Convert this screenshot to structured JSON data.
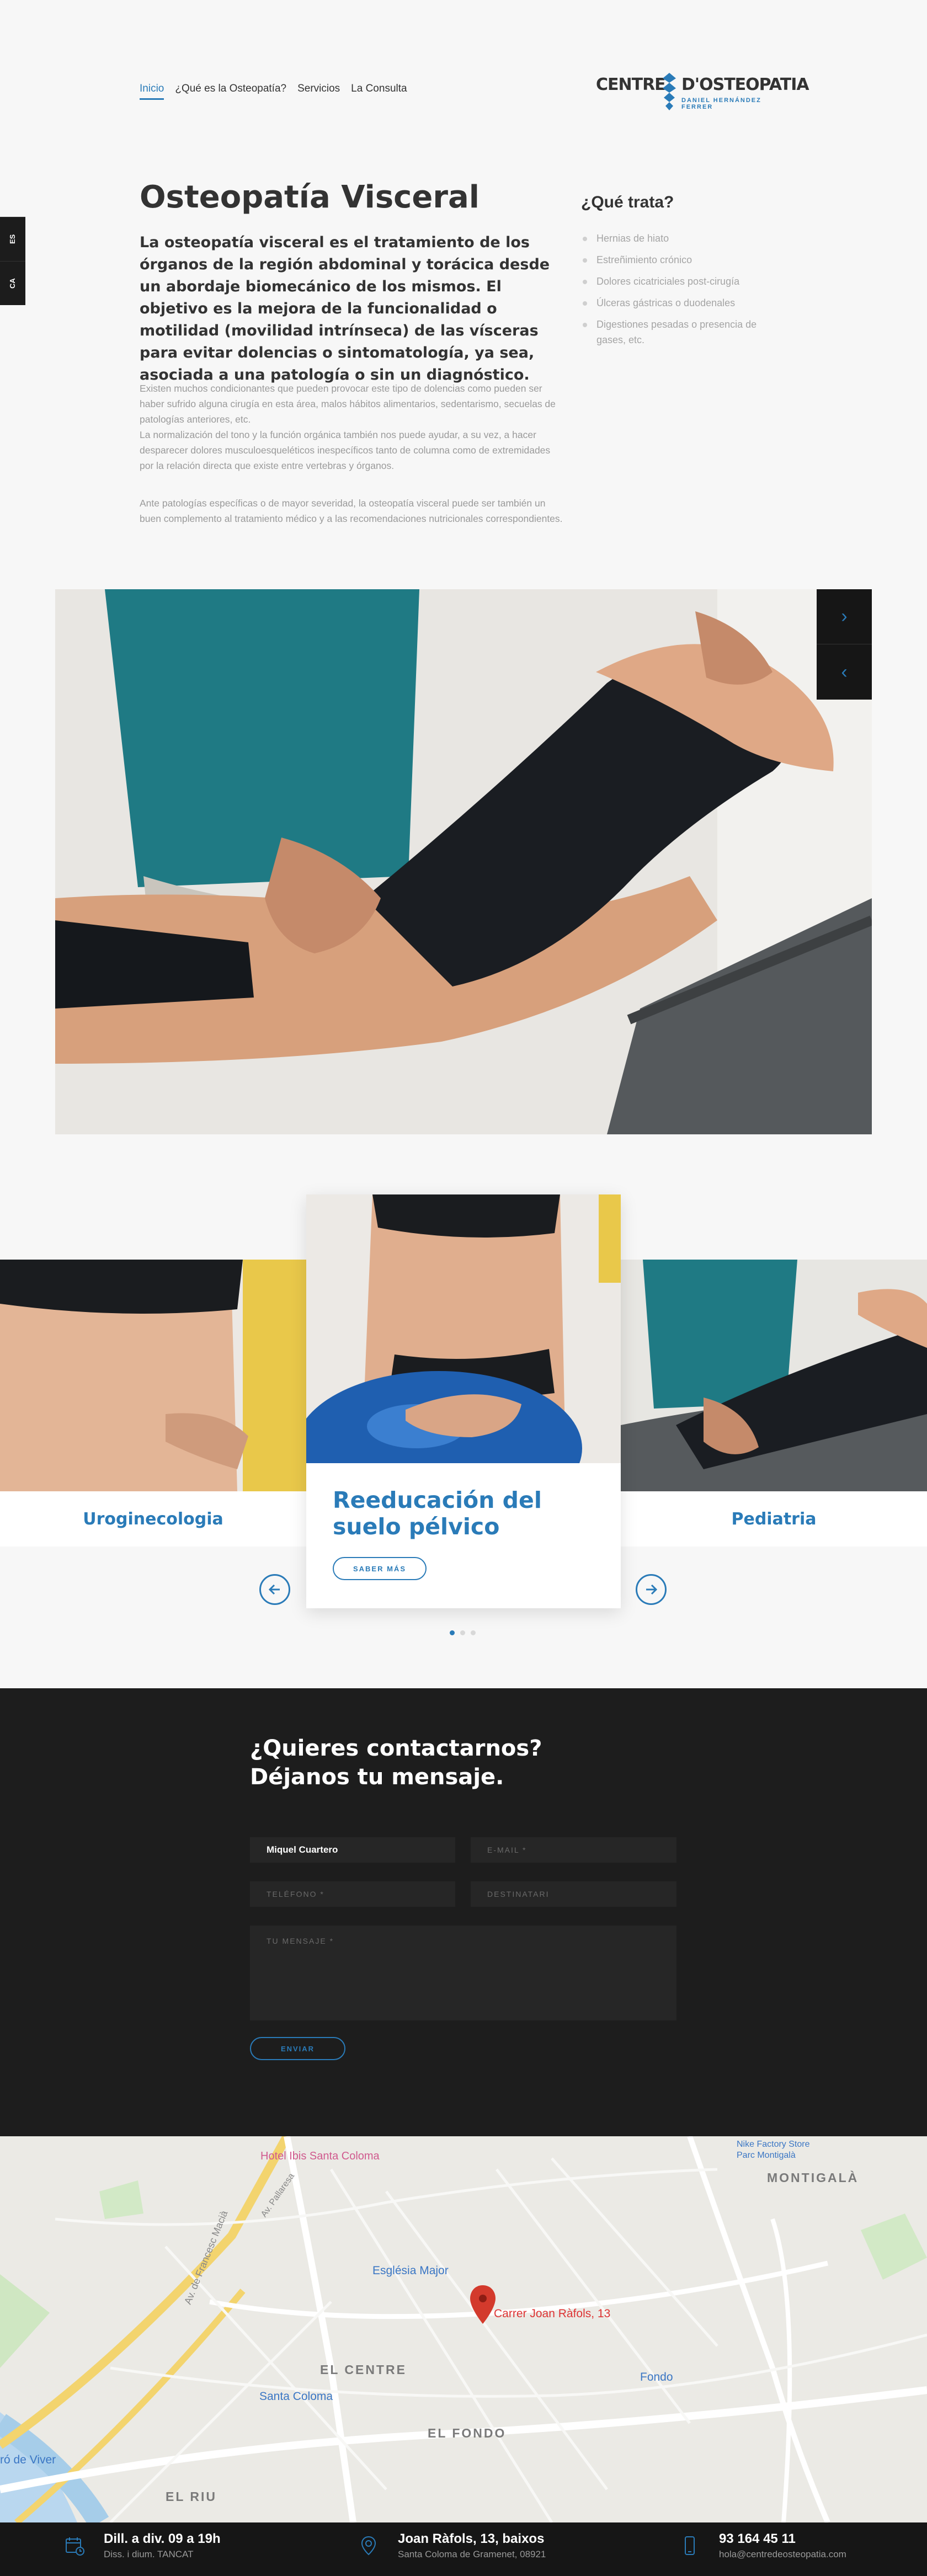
{
  "nav": {
    "items": [
      "Inicio",
      "¿Qué es la Osteopatía?",
      "Servicios",
      "La Consulta"
    ],
    "active_index": 0
  },
  "logo": {
    "word1": "CENTRE",
    "word2": "D'OSTEOPATIA",
    "subtitle": "DANIEL HERNÁNDEZ FERRER"
  },
  "lang": [
    "ES",
    "CA"
  ],
  "intro": {
    "title": "Osteopatía Visceral",
    "lead": "La osteopatía visceral es el tratamiento de los órganos de la región abdominal y torácica desde un abordaje biomecánico de los mismos. El objetivo es la mejora de la funcionalidad o motilidad (movilidad intrínseca) de las vísceras para evitar dolencias o sintomatología, ya sea, asociada a una patología o sin un diagnóstico.",
    "p1": "Existen muchos condicionantes que pueden provocar este tipo de dolencias como pueden ser haber sufrido alguna cirugía en esta área, malos hábitos alimentarios, sed­entarismo, secuelas de patologías anteriores, etc.",
    "p2": "La normalización del tono y la función orgánica también nos puede ayudar, a su vez, a hacer desparecer dolores musculoesqueléticos inespecíficos tanto de columna como de extremidades por la relación directa que existe entre vertebras y órganos.",
    "p3": "Ante patologías específicas o de mayor severidad, la osteopatía visceral puede ser también un buen complemento al tratamiento médico y a las recomendaciones nutri­cionales correspondientes."
  },
  "treats": {
    "title": "¿Qué trata?",
    "items": [
      "Hernias de hiato",
      "Estreñimiento crónico",
      "Dolores cicatriciales post-cirugía",
      "Úlceras gástricas o duodenales",
      "Digestiones pesadas o presencia de gases, etc."
    ]
  },
  "hero_nav": {
    "next": "›",
    "prev": "‹"
  },
  "carousel": {
    "left_label": "Uroginecologia",
    "center_title": "Reeducación del suelo pélvico",
    "center_button": "SABER MÁS",
    "right_label": "Pediatria",
    "prev_icon": "arrow-left-icon",
    "next_icon": "arrow-right-icon",
    "active_dot": 0,
    "dot_count": 3
  },
  "contact": {
    "title_line1": "¿Quieres contactarnos?",
    "title_line2": "Déjanos tu mensaje.",
    "name_value": "Miquel Cuartero",
    "email_placeholder": "E-MAIL *",
    "phone_placeholder": "TELÉFONO *",
    "recipient_placeholder": "DESTINATARI",
    "message_placeholder": "TU MENSAJE *",
    "submit": "ENVIAR"
  },
  "map": {
    "labels": {
      "hotel": "Hotel Ibis Santa Coloma",
      "nike": "Nike Factory Store Parc Montigalà",
      "montigala": "MONTIGALÀ",
      "esglesia": "Església Major",
      "address": "Carrer Joan Ràfols, 13",
      "el_centre": "EL CENTRE",
      "santa_coloma": "Santa Coloma",
      "fondo": "Fondo",
      "el_fondo": "EL FONDO",
      "el_riu": "EL RIU",
      "viver": "ró de Viver",
      "francesc": "Av. de Francesc Macià",
      "pallaresa": "Av. Pallaresa"
    },
    "accent": "#d33a2c"
  },
  "footer": {
    "hours_title": "Dill. a div. 09 a 19h",
    "hours_sub": "Diss. i dium. TANCAT",
    "addr_title": "Joan Ràfols, 13, baixos",
    "addr_sub": "Santa Coloma de Gramenet, 08921",
    "phone_title": "93 164 45 11",
    "phone_sub": "hola@centredeosteopatia.com"
  },
  "colors": {
    "accent": "#2a7bb8",
    "dark": "#1d1d1d",
    "background": "#f7f7f7"
  }
}
